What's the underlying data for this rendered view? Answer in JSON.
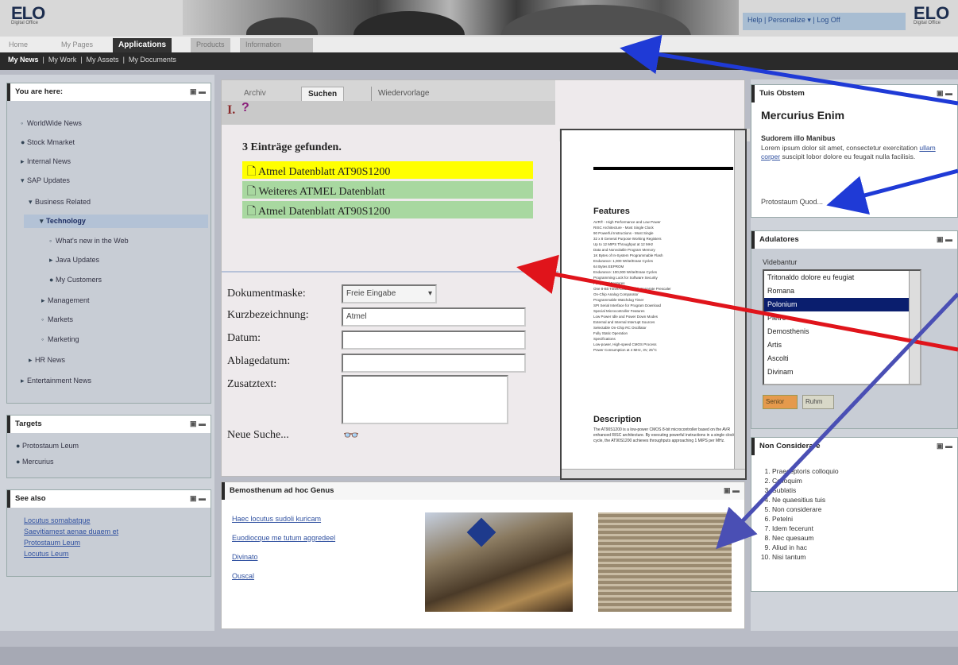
{
  "header": {
    "logo": "ELO",
    "logo_sub": "Digital Office",
    "links": "Help  |  Personalize ▾  |  Log Off"
  },
  "top_tabs": [
    "Home",
    "My Pages",
    "Applications",
    "Products",
    "Information"
  ],
  "sub_nav": {
    "active": "My News",
    "items": [
      "My Work",
      "My Assets",
      "My Documents"
    ]
  },
  "left": {
    "you_are_here": {
      "title": "You are here:",
      "items": [
        {
          "label": "WorldWide News",
          "level": 1
        },
        {
          "label": "Stock Mmarket",
          "level": 1
        },
        {
          "label": "Internal News",
          "level": 1
        },
        {
          "label": "SAP Updates",
          "level": 1
        },
        {
          "label": "Business Related",
          "level": 2
        },
        {
          "label": "Technology",
          "level": 3
        },
        {
          "label": "What's new in the Web",
          "level": 4
        },
        {
          "label": "Java Updates",
          "level": 4
        },
        {
          "label": "My Customers",
          "level": 4
        },
        {
          "label": "Management",
          "level": 3
        },
        {
          "label": "Markets",
          "level": 3
        },
        {
          "label": "Marketing",
          "level": 3
        },
        {
          "label": "HR News",
          "level": 2
        },
        {
          "label": "Entertainment News",
          "level": 1
        }
      ]
    },
    "targets": {
      "title": "Targets",
      "items": [
        "Protostaum Leum",
        "Mercurius"
      ]
    },
    "see_also": {
      "title": "See also",
      "links": [
        "Locutus somabatque",
        "Saevitiamest aenae duaem et",
        "Protostaum Leum",
        "Locutus Leum"
      ]
    }
  },
  "center": {
    "tabs": [
      "Archiv",
      "Suchen",
      "Wiedervorlage"
    ],
    "result_count": "3 Einträge gefunden.",
    "results": [
      "Atmel Datenblatt AT90S1200",
      "Weiteres ATMEL Datenblatt",
      "Atmel Datenblatt AT90S1200"
    ],
    "form": {
      "labels": [
        "Dokumentmaske:",
        "Kurzbezeichnung:",
        "Datum:",
        "Ablagedatum:",
        "Zusatztext:"
      ],
      "mask_value": "Freie Eingabe",
      "kurz_value": "Atmel",
      "new_search": "Neue Suche..."
    },
    "viewer": {
      "heading1": "Features",
      "heading2": "Description",
      "lines": [
        "AVR® - High Performance and Low Power",
        "RISC Architecture - Most Single Clock",
        "90 Powerful Instructions - Most Single",
        "32 x 8 General Purpose Working Registers",
        "Up to 12 MIPS Throughput at 12 MHz",
        "Data and Nonvolatile Program Memory",
        "1K Bytes of In-System Programmable Flash",
        "Endurance: 1,000 Write/Erase Cycles",
        "64 Bytes EEPROM",
        "Endurance: 100,000 Write/Erase Cycles",
        "Programming Lock for Software Security",
        "Peripheral Features",
        "One 8-Bit Timer/Counter with Separate Prescaler",
        "On-Chip Analog Comparator",
        "Programmable Watchdog Timer",
        "SPI Serial Interface for Program Download",
        "Special Microcontroller Features",
        "Low Power Idle and Power Down Modes",
        "External and Internal Interrupt Sources",
        "Selectable On-Chip RC Oscillator",
        "Fully Static Operation",
        "Specifications",
        "Low-power, High-speed CMOS Process",
        "Power Consumption at 4 MHz, 3V, 25°C"
      ],
      "desc": "The AT90S1200 is a low-power CMOS 8-bit microcontroller based on the AVR enhanced RISC architecture. By executing powerful instructions in a single clock cycle, the AT90S1200 achieves throughputs approaching 1 MIPS per MHz."
    },
    "bottom": {
      "title": "Bemosthenum ad hoc Genus",
      "links": [
        "Haec locutus sudoli kuricam",
        "Euodiocque me tutum aggredeel",
        "Divinato",
        "Ouscal"
      ]
    }
  },
  "right": {
    "tuis": {
      "title": "Tuis Obstem",
      "heading": "Mercurius Enim",
      "subheading": "Sudorem illo Manibus",
      "text1": "Lorem ipsum dolor sit amet, consectetur exercitation ",
      "link": "ullam corper",
      "text2": " suscipit lobor dolore eu feugait nulla facilisis.",
      "footer": "Protostaum Quod..."
    },
    "adulatores": {
      "title": "Adulatores",
      "label": "Videbantur",
      "options": [
        "Tritonaldo dolore eu feugiat",
        "Romana",
        "Polonium",
        "Pietro",
        "Demosthenis",
        "Artis",
        "Ascolti",
        "Divinam"
      ],
      "selected": 2,
      "btn1": "Senior",
      "btn2": "Ruhm"
    },
    "non_considerare": {
      "title": "Non Considerare",
      "items": [
        "Praeceptoris colloquio",
        "Colloquim",
        "Sublatis",
        "Ne quaesitius tuis",
        "Non considerare",
        "Petelni",
        "Idem fecerunt",
        "Nec quesaum",
        "Aliud in hac",
        "Nisi tantum"
      ]
    }
  },
  "colors": {
    "accent_blue": "#1f3ad6",
    "accent_red": "#e0141b",
    "highlight_yellow": "#ffff00",
    "highlight_green": "#a8d8a0"
  }
}
